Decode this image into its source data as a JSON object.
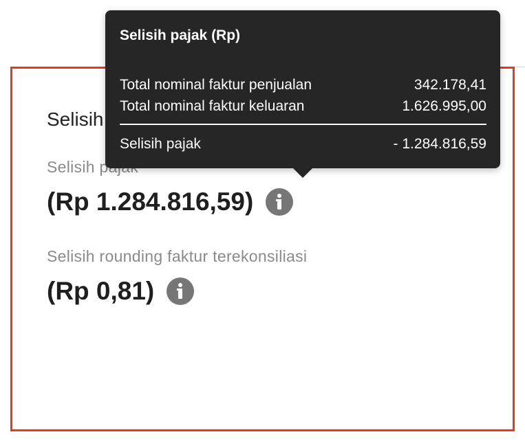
{
  "card": {
    "title": "Selisih"
  },
  "fields": [
    {
      "label": "Selisih pajak",
      "value": "(Rp 1.284.816,59)"
    },
    {
      "label": "Selisih rounding faktur terekonsiliasi",
      "value": "(Rp 0,81)"
    }
  ],
  "tooltip": {
    "title": "Selisih pajak (Rp)",
    "rows": [
      {
        "label": "Total nominal faktur penjualan",
        "value": "342.178,41"
      },
      {
        "label": "Total nominal faktur keluaran",
        "value": "1.626.995,00"
      }
    ],
    "total": {
      "label": "Selisih pajak",
      "value": "- 1.284.816,59"
    }
  },
  "colors": {
    "card_border": "#e8381e",
    "tooltip_bg": "#262626",
    "icon": "#767676"
  },
  "icons": {
    "info": "info-icon"
  }
}
